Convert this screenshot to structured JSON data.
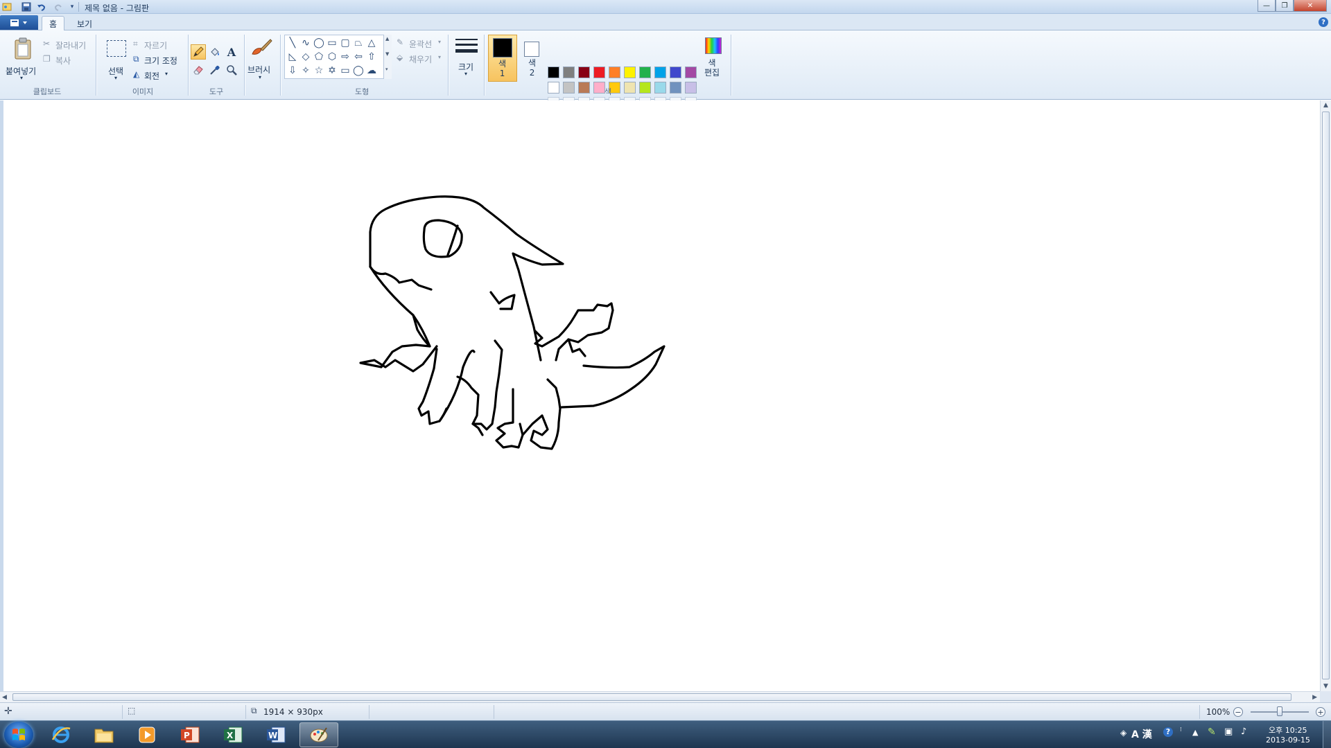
{
  "window": {
    "title": "제목 없음 - 그림판",
    "minimize_glyph": "—",
    "maximize_glyph": "❐",
    "close_glyph": "✕"
  },
  "tabs": [
    {
      "label": "홈",
      "active": true
    },
    {
      "label": "보기",
      "active": false
    }
  ],
  "ribbon": {
    "clipboard": {
      "group_label": "클립보드",
      "paste": "붙여넣기",
      "cut": "잘라내기",
      "copy": "복사"
    },
    "image": {
      "group_label": "이미지",
      "select": "선택",
      "crop": "자르기",
      "resize": "크기 조정",
      "rotate": "회전"
    },
    "tools": {
      "group_label": "도구",
      "selected_tool": "pencil-icon"
    },
    "brushes": {
      "label": "브러시"
    },
    "shapes": {
      "group_label": "도형",
      "outline": "윤곽선",
      "fill": "채우기"
    },
    "size": {
      "label": "크기"
    },
    "colors": {
      "group_label": "색",
      "color1_label": "색\n1",
      "color2_label": "색\n2",
      "edit_label": "색\n편집",
      "color1": "#000000",
      "color2": "#ffffff",
      "palette_row1": [
        "#000000",
        "#7f7f7f",
        "#880015",
        "#ed1c24",
        "#ff7f27",
        "#fff200",
        "#22b14c",
        "#00a2e8",
        "#3f48cc",
        "#a349a4"
      ],
      "palette_row2": [
        "#ffffff",
        "#c3c3c3",
        "#b97a57",
        "#ffaec9",
        "#ffc90e",
        "#efe4b0",
        "#b5e61d",
        "#99d9ea",
        "#7092be",
        "#c8bfe7"
      ]
    }
  },
  "status": {
    "canvas_size": "1914 × 930px",
    "zoom": "100%",
    "zoom_fraction": 0.5
  },
  "taskbar": {
    "apps": [
      "internet-explorer-icon",
      "file-explorer-icon",
      "media-player-icon",
      "powerpoint-icon",
      "excel-icon",
      "word-icon",
      "paint-icon"
    ],
    "active_app": "paint-icon",
    "ime_label": "A 漢",
    "time": "오후 10:25",
    "date": "2013-09-15"
  }
}
